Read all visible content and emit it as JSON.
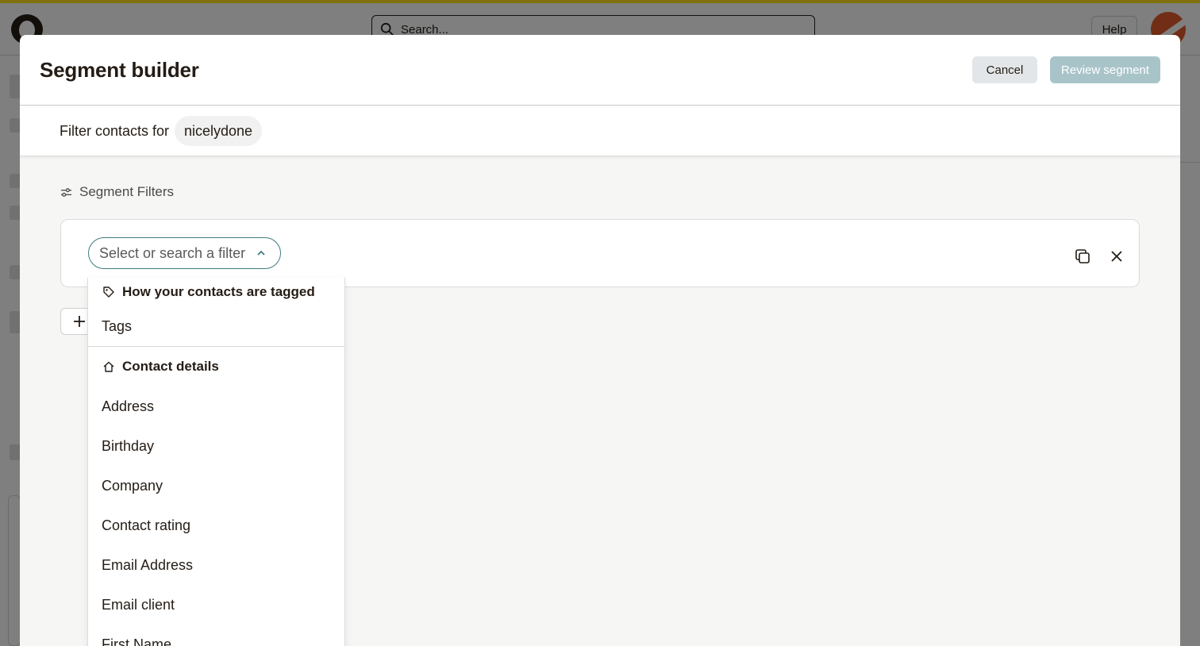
{
  "background": {
    "search_placeholder": "Search...",
    "help_label": "Help"
  },
  "modal": {
    "title": "Segment builder",
    "cancel_label": "Cancel",
    "review_label": "Review segment",
    "filter_contacts_label": "Filter contacts for",
    "audience_name": "nicelydone",
    "segment_filters_heading": "Segment Filters",
    "filter_select_placeholder": "Select or search a filter"
  },
  "dropdown": {
    "groups": [
      {
        "label": "How your contacts are tagged",
        "icon": "tag-icon",
        "items": [
          "Tags"
        ]
      },
      {
        "label": "Contact details",
        "icon": "home-icon",
        "items": [
          "Address",
          "Birthday",
          "Company",
          "Contact rating",
          "Email Address",
          "Email client",
          "First Name"
        ]
      }
    ]
  },
  "colors": {
    "accent_bar": "#ffe01b",
    "select_border": "#3f7a7e",
    "review_button": "#a9c4c9",
    "cancel_button": "#e3e6e8"
  }
}
